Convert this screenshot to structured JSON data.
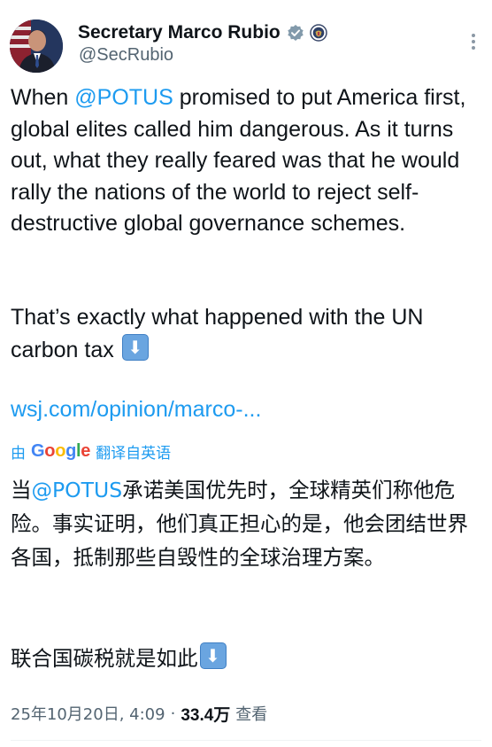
{
  "author": {
    "name": "Secretary Marco Rubio",
    "handle": "@SecRubio"
  },
  "tweet": {
    "para1_prefix": "When ",
    "para1_mention": "@POTUS",
    "para1_rest": " promised to put America first, global elites called him dangerous. As it turns out, what they really feared was that he would rally the nations of the world to reject self-destructive global governance schemes.",
    "para2_text": "That’s exactly what happened with the UN carbon tax",
    "link_text": "wsj.com/opinion/marco-..."
  },
  "translation": {
    "by": "由",
    "google": "Google",
    "action": "翻译自英语",
    "para1_prefix": "当",
    "para1_mention": "@POTUS",
    "para1_rest": "承诺美国优先时，全球精英们称他危险。事实证明，他们真正担心的是，他会团结世界各国，抵制那些自毁性的全球治理方案。",
    "para2_text": "联合国碳税就是如此"
  },
  "meta": {
    "timestamp": "25年10月20日, 4:09",
    "separator": "·",
    "views_count": "33.4万",
    "views_label": "查看"
  },
  "icons": {
    "verified": "verified-badge-icon",
    "seal": "state-department-seal-icon",
    "more": "more-options-icon",
    "emoji": "down-arrow-emoji-icon"
  },
  "colors": {
    "link": "#1d9bf0",
    "text": "#0f1419",
    "muted": "#536471"
  }
}
